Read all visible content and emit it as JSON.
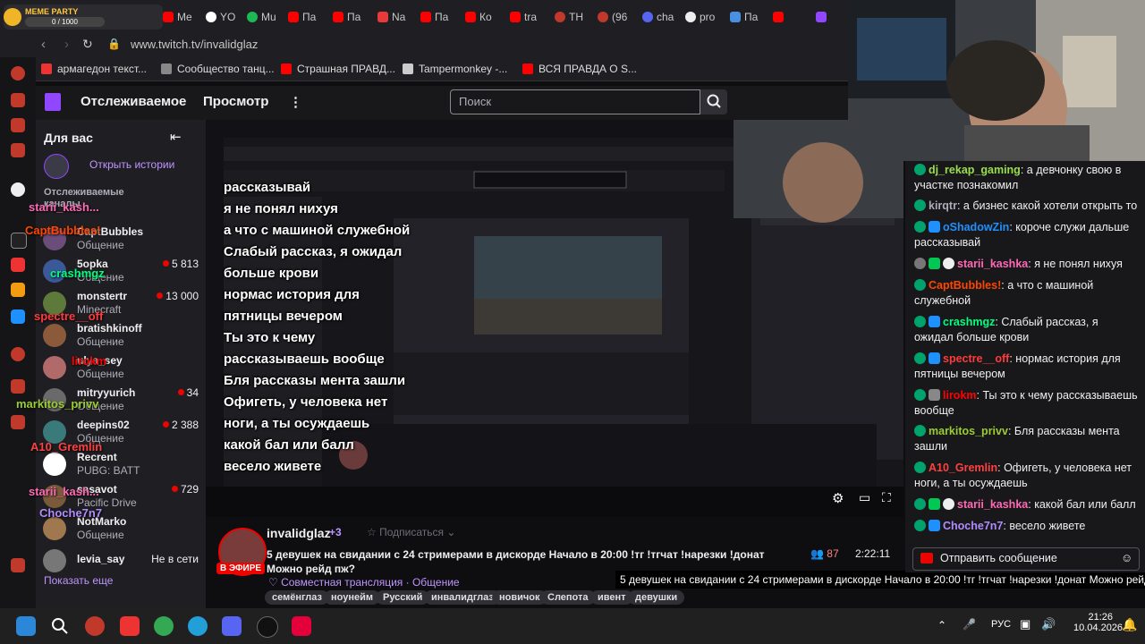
{
  "browser": {
    "tabs": [
      {
        "label": "MEME PARTY",
        "sub": "0 / 1000"
      },
      {
        "label": "Me"
      },
      {
        "label": "YO"
      },
      {
        "label": "Mu"
      },
      {
        "label": "Па"
      },
      {
        "label": "Па"
      },
      {
        "label": "Na"
      },
      {
        "label": "Па"
      },
      {
        "label": "Ко"
      },
      {
        "label": "tra"
      },
      {
        "label": "TH"
      },
      {
        "label": "(96"
      },
      {
        "label": "cha"
      },
      {
        "label": "pro"
      },
      {
        "label": "Па"
      }
    ],
    "url": "www.twitch.tv/invalidglaz",
    "bookmarks": [
      {
        "label": "армагедон текст..."
      },
      {
        "label": "Сообщество танц..."
      },
      {
        "label": "Страшная ПРАВД..."
      },
      {
        "label": "Tampermonkey -..."
      },
      {
        "label": "ВСЯ ПРАВДА О S..."
      }
    ]
  },
  "twitch": {
    "nav": {
      "following": "Отслеживаемое",
      "browse": "Просмотр",
      "more": "⋮",
      "search_placeholder": "Поиск"
    },
    "sidebar": {
      "header": "Для вас",
      "open_stories": "Открыть истории",
      "section_label": "Отслеживаемые каналы",
      "channels": [
        {
          "name": "CaptBubbles",
          "game": "Общение",
          "viewers": "",
          "color": "#6b4d7a"
        },
        {
          "name": "5opka",
          "game": "Общение",
          "viewers": "5 813",
          "color": "#3b5998"
        },
        {
          "name": "monstertr",
          "game": "Minecraft",
          "viewers": "13 000",
          "color": "#5e7a3b"
        },
        {
          "name": "bratishkinoff",
          "game": "Общение",
          "viewers": "",
          "color": "#8a5a3b"
        },
        {
          "name": "ulya_sey",
          "game": "Общение",
          "viewers": "",
          "color": "#b06a6a"
        },
        {
          "name": "mitryyurich",
          "game": "Общение",
          "viewers": "34",
          "color": "#6a6a6a"
        },
        {
          "name": "deepins02",
          "game": "Общение",
          "viewers": "2 388",
          "color": "#3b7a7a"
        },
        {
          "name": "Recrent",
          "game": "PUBG: BATT",
          "viewers": "",
          "color": "#ffffff"
        },
        {
          "name": "sasavot",
          "game": "Pacific Drive",
          "viewers": "729",
          "color": "#7a5a3b"
        },
        {
          "name": "NotMarko",
          "game": "Общение",
          "viewers": "",
          "color": "#a07850"
        }
      ],
      "offline_channel": {
        "name": "levia_say",
        "status": "Не в сети"
      },
      "show_more": "Показать еще"
    },
    "overlay_messages": [
      {
        "user": "starii_kash...",
        "text": "рассказывай"
      },
      {
        "user": "",
        "text": "я не понял нихуя"
      },
      {
        "user": "CaptBubbles!",
        "text": "а что с машиной служебной"
      },
      {
        "user": "crashmgz",
        "text": "Слабый рассказ, я ожидал больше крови"
      },
      {
        "user": "spectre__off",
        "text": "нормас история для пятницы вечером"
      },
      {
        "user": "lirokm",
        "text": "Ты это к чему рассказываешь вообще"
      },
      {
        "user": "markitos_privv",
        "text": "Бля рассказы мента зашли"
      },
      {
        "user": "A10_Gremlin",
        "text": "Офигеть, у человека нет ноги, а ты осуждаешь"
      },
      {
        "user": "starii_kash...",
        "text": "какой бал или балл"
      },
      {
        "user": "Choche7n7",
        "text": "весело живете"
      }
    ],
    "stream": {
      "live_badge": "В ЭФИРЕ",
      "channel": "invalidglaz",
      "extra": "+3",
      "follow": "Подписаться",
      "title": "5 девушек на свидании с 24 стримерами в дискорде Начало в 20:00 !тг !тгчат !нарезки !донат Можно рейд пж?",
      "category": "Совместная трансляция",
      "category2": "Общение",
      "viewers": "87",
      "uptime": "2:22:11",
      "tooltip": "5 девушек на свидании с 24 стримерами в дискорде Начало в 20:00 !тг !тгчат !нарезки !донат Можно рейд пж?",
      "tags": [
        "семёнглаз",
        "ноунейм",
        "Русский",
        "инвалидглаз",
        "новичок",
        "Слепота",
        "ивент",
        "девушки"
      ]
    },
    "chat": {
      "messages": [
        {
          "user": "dj_rekap_gaming",
          "text": "а девчонку свою в участке познакомил",
          "color": "#9ade4c"
        },
        {
          "user": "kirqtr",
          "text": "а бизнес какой хотели открыть то",
          "color": "#adadb8"
        },
        {
          "user": "oShadowZin",
          "text": "короче служи дальше рассказывай",
          "color": "#1e90ff"
        },
        {
          "user": "starii_kashka",
          "text": "я не понял нихуя",
          "color": "#ff69b4"
        },
        {
          "user": "CaptBubbles!",
          "text": "а что с машиной служебной",
          "color": "#ff4500"
        },
        {
          "user": "crashmgz",
          "text": "Слабый рассказ, я ожидал больше крови",
          "color": "#00ff7f"
        },
        {
          "user": "spectre__off",
          "text": "нормас история для пятницы вечером",
          "color": "#ff3b3b"
        },
        {
          "user": "lirokm",
          "text": "Ты это к чему рассказываешь вообще",
          "color": "#ff0000"
        },
        {
          "user": "markitos_privv",
          "text": "Бля рассказы мента зашли",
          "color": "#9acd32"
        },
        {
          "user": "A10_Gremlin",
          "text": "Офигеть, у человека нет ноги, а ты осуждаешь",
          "color": "#ff4040"
        },
        {
          "user": "starii_kashka",
          "text": "какой бал или балл",
          "color": "#ff69b4"
        },
        {
          "user": "Choche7n7",
          "text": "весело живете",
          "color": "#b18cff"
        }
      ],
      "input_placeholder": "Отправить сообщение"
    }
  },
  "taskbar": {
    "lang": "РУС",
    "time": "21:26",
    "date": "10.04.2026"
  },
  "colors": {
    "twitch_purple": "#9147ff",
    "live_red": "#eb0400"
  }
}
